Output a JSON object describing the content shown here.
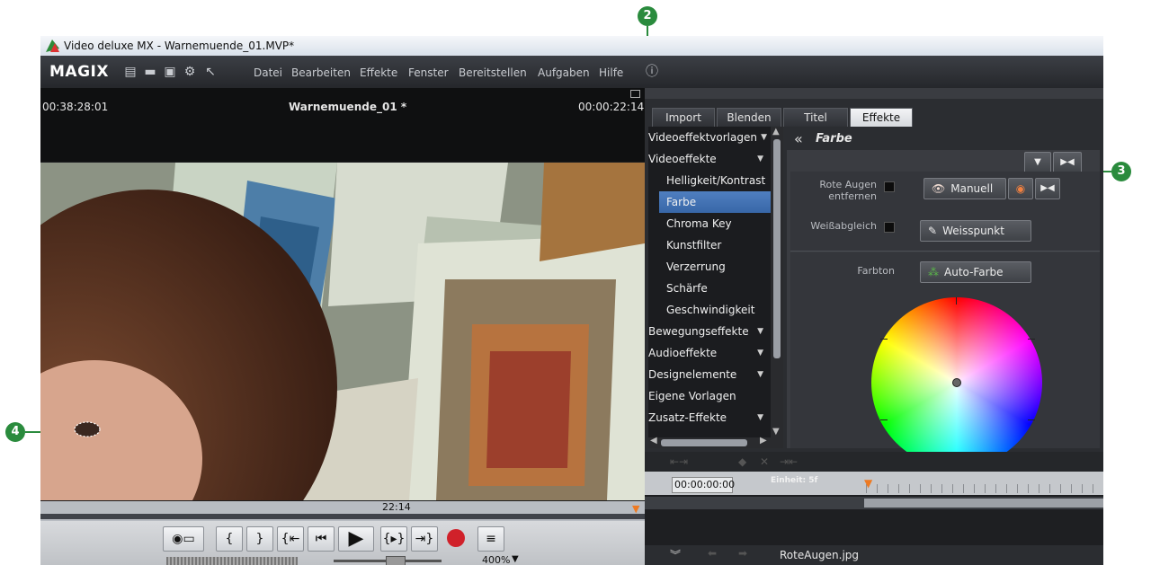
{
  "window": {
    "title": "Video deluxe MX - Warnemuende_01.MVP*"
  },
  "menubar": {
    "logo": "MAGIX",
    "items": [
      "Datei",
      "Bearbeiten",
      "Effekte",
      "Fenster",
      "Bereitstellen",
      "Aufgaben",
      "Hilfe"
    ]
  },
  "preview": {
    "timecode_left": "00:38:28:01",
    "clip_title": "Warnemuende_01 *",
    "timecode_right": "00:00:22:14",
    "position_label": "22:14",
    "zoom": "400%"
  },
  "tabs": [
    {
      "label": "Import"
    },
    {
      "label": "Blenden"
    },
    {
      "label": "Titel"
    },
    {
      "label": "Effekte",
      "active": true
    }
  ],
  "categories": {
    "video_presets": "Videoeffektvorlagen",
    "video_effects": "Videoeffekte",
    "sub_items": [
      "Helligkeit/Kontrast",
      "Farbe",
      "Chroma Key",
      "Kunstfilter",
      "Verzerrung",
      "Schärfe",
      "Geschwindigkeit"
    ],
    "selected": "Farbe",
    "more": [
      "Bewegungseffekte",
      "Audioeffekte",
      "Designelemente",
      "Eigene Vorlagen",
      "Zusatz-Effekte"
    ]
  },
  "effect_panel": {
    "back_glyph": "«",
    "title": "Farbe",
    "red_eye_label": "Rote Augen entfernen",
    "manual_button": "Manuell",
    "white_balance_label": "Weißabgleich",
    "white_point_button": "Weisspunkt",
    "hue_label": "Farbton",
    "auto_color_button": "Auto-Farbe"
  },
  "timeline": {
    "timecode": "00:00:00:00",
    "unit_label": "Einheit: 5f",
    "clip_name": "RoteAugen.jpg"
  },
  "callouts": [
    "2",
    "3",
    "4"
  ],
  "colors": {
    "accent_selected": "#3e6fb2",
    "callout": "#2a8b3d",
    "record": "#d0212a"
  }
}
